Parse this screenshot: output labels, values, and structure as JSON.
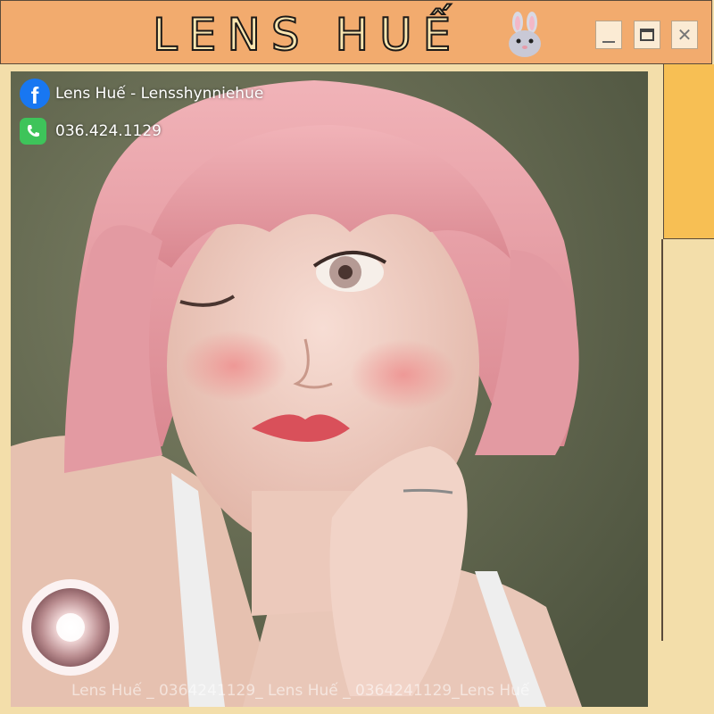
{
  "window": {
    "title": "LENS HUẾ",
    "title_emoji": "🐰",
    "controls": {
      "minimize": "minimize-icon",
      "maximize": "maximize-icon",
      "close": "close-icon"
    }
  },
  "contacts": {
    "facebook": {
      "icon": "facebook-icon",
      "text": "Lens Huế - Lensshynniehue"
    },
    "phone": {
      "icon": "whatsapp-phone-icon",
      "text": "036.424.1129"
    }
  },
  "photo": {
    "watermark": "Lens Huế _ 0364241129_ Lens Huế _ 0364241129_Lens Huế"
  },
  "colors": {
    "background": "#f3deaa",
    "titlebar": "#f2ab6e",
    "side_panel": "#f7bf54",
    "hair": "#e99aa0",
    "wall": "#6c7258"
  }
}
